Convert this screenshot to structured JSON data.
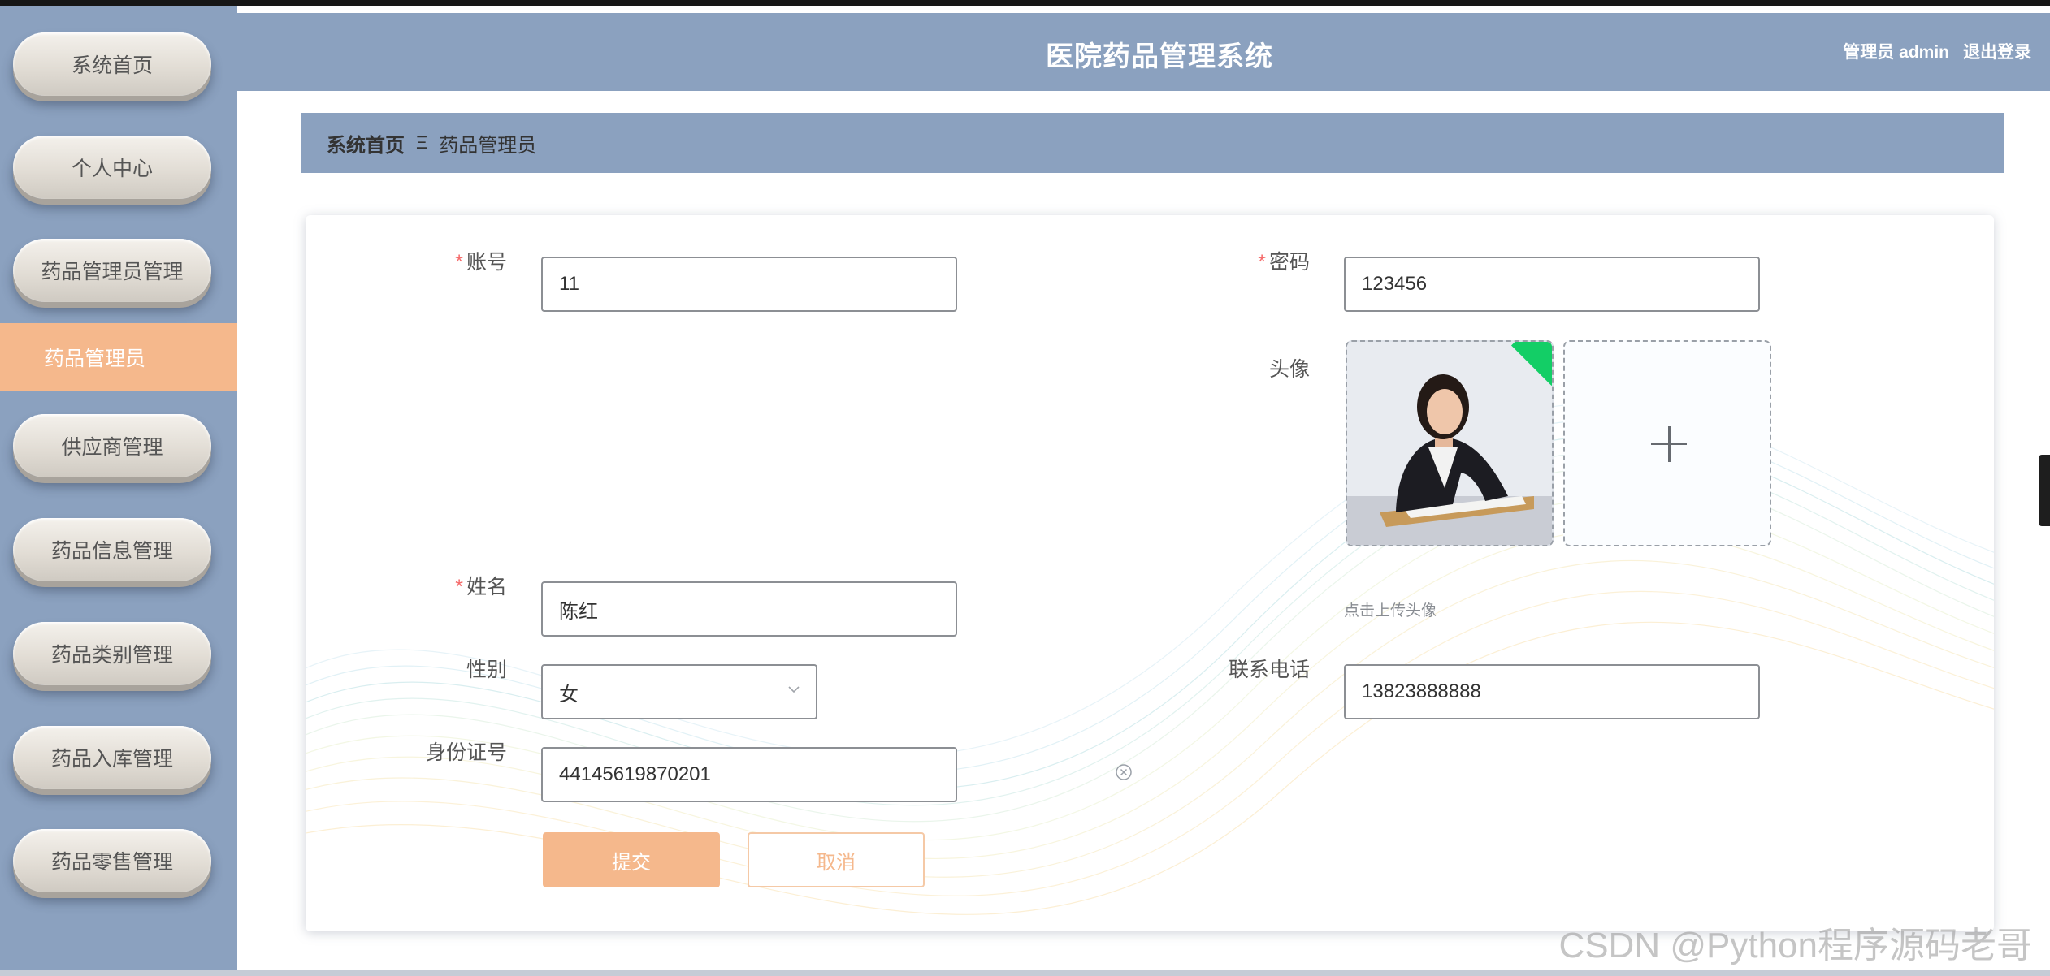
{
  "app": {
    "title": "医院药品管理系统",
    "user_label": "管理员 admin",
    "logout_label": "退出登录"
  },
  "sidebar": {
    "items": [
      {
        "label": "系统首页"
      },
      {
        "label": "个人中心"
      },
      {
        "label": "药品管理员管理"
      },
      {
        "label": "药品管理员",
        "active": true
      },
      {
        "label": "供应商管理"
      },
      {
        "label": "药品信息管理"
      },
      {
        "label": "药品类别管理"
      },
      {
        "label": "药品入库管理"
      },
      {
        "label": "药品零售管理"
      }
    ]
  },
  "breadcrumb": {
    "home": "系统首页",
    "separator": "Ξ",
    "current": "药品管理员"
  },
  "form": {
    "account": {
      "label": "账号",
      "value": "11",
      "required": true
    },
    "password": {
      "label": "密码",
      "value": "123456",
      "required": true
    },
    "avatar": {
      "label": "头像",
      "hint": "点击上传头像"
    },
    "name": {
      "label": "姓名",
      "value": "陈红",
      "required": true
    },
    "gender": {
      "label": "性别",
      "value": "女"
    },
    "phone": {
      "label": "联系电话",
      "value": "13823888888"
    },
    "id_number": {
      "label": "身份证号",
      "value": "44145619870201"
    },
    "submit_label": "提交",
    "cancel_label": "取消"
  },
  "required_mark": "*",
  "watermark": "CSDN @Python程序源码老哥",
  "colors": {
    "sidebar_bg": "#8ba1bf",
    "header_bg": "#8ba1bf",
    "accent": "#f5b88c",
    "required": "#f56c6c",
    "avatar_tag": "#13ce66"
  },
  "icons": {
    "gender_select": "chevron-down-icon",
    "id_clear": "circle-close-icon",
    "upload": "plus-icon"
  }
}
